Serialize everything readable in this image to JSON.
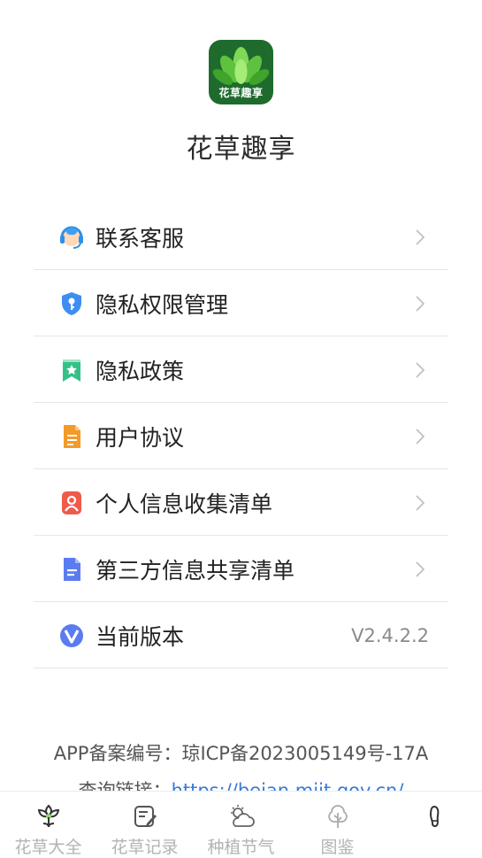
{
  "app": {
    "logo_text": "花草趣享",
    "name": "花草趣享"
  },
  "menu": [
    {
      "label": "联系客服",
      "icon": "customer-service-icon",
      "color": "#3aa0f0"
    },
    {
      "label": "隐私权限管理",
      "icon": "shield-key-icon",
      "color": "#3d8ef0"
    },
    {
      "label": "隐私政策",
      "icon": "bookmark-star-icon",
      "color": "#35c08a"
    },
    {
      "label": "用户协议",
      "icon": "document-icon",
      "color": "#f39a2a"
    },
    {
      "label": "个人信息收集清单",
      "icon": "person-card-icon",
      "color": "#f05a4a"
    },
    {
      "label": "第三方信息共享清单",
      "icon": "file-list-icon",
      "color": "#5b7cf0"
    },
    {
      "label": "当前版本",
      "icon": "version-v-icon",
      "color": "#5b7cf0",
      "value": "V2.4.2.2"
    }
  ],
  "footer": {
    "record": "APP备案编号：琼ICP备2023005149号-17A",
    "query_label": "查询链接：",
    "query_link": "https://beian.miit.gov.cn/"
  },
  "tabs": [
    {
      "label": "花草大全",
      "icon": "flower-icon"
    },
    {
      "label": "花草记录",
      "icon": "note-edit-icon"
    },
    {
      "label": "种植节气",
      "icon": "weather-cloud-icon"
    },
    {
      "label": "图鉴",
      "icon": "tree-icon"
    },
    {
      "label": "",
      "icon": "footprint-icon"
    }
  ]
}
